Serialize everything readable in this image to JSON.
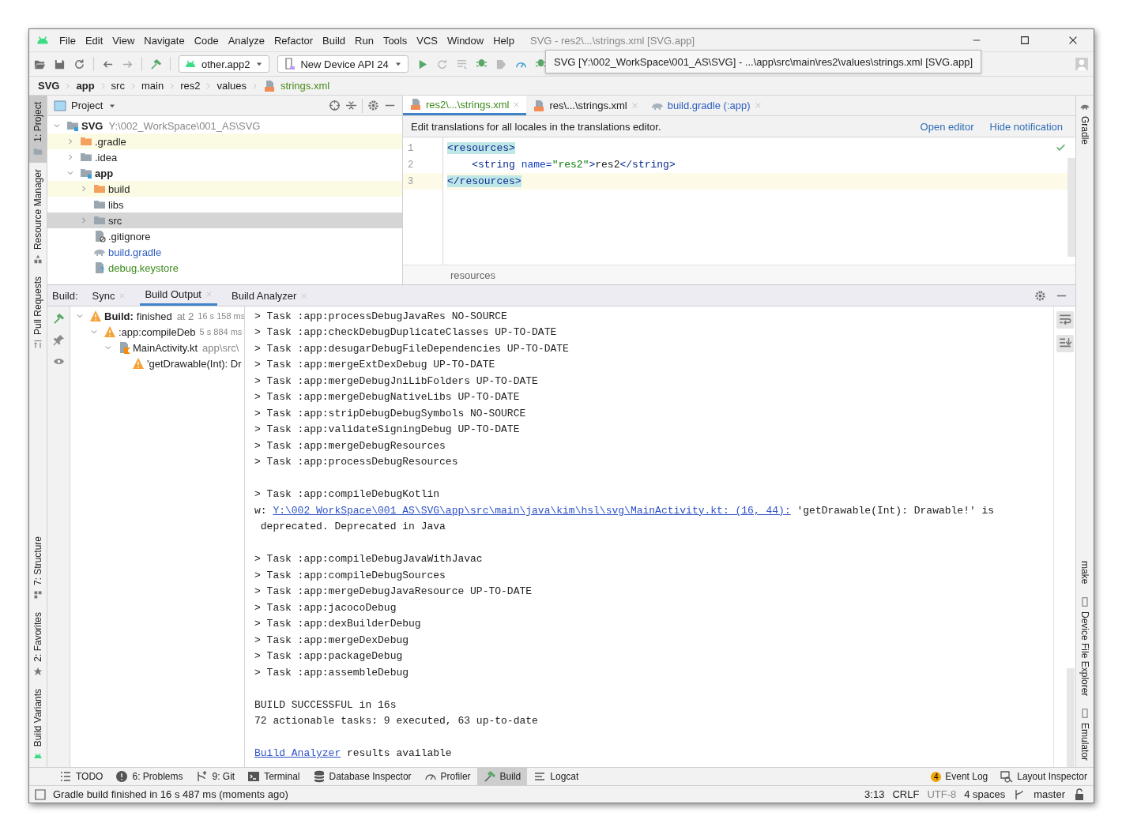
{
  "window": {
    "title": "SVG - res2\\...\\strings.xml [SVG.app]"
  },
  "menu": [
    "File",
    "Edit",
    "View",
    "Navigate",
    "Code",
    "Analyze",
    "Refactor",
    "Build",
    "Run",
    "Tools",
    "VCS",
    "Window",
    "Help"
  ],
  "toolbar": {
    "run_config": "other.app2",
    "device": "New Device API 24"
  },
  "tooltip": "SVG [Y:\\002_WorkSpace\\001_AS\\SVG] - ...\\app\\src\\main\\res2\\values\\strings.xml [SVG.app]",
  "breadcrumb": [
    {
      "label": "SVG",
      "bold": true,
      "kind": "dir"
    },
    {
      "label": "app",
      "bold": true,
      "kind": "dir"
    },
    {
      "label": "src",
      "bold": false,
      "kind": "dir"
    },
    {
      "label": "main",
      "bold": false,
      "kind": "dir"
    },
    {
      "label": "res2",
      "bold": false,
      "kind": "dir"
    },
    {
      "label": "values",
      "bold": false,
      "kind": "dir"
    },
    {
      "label": "strings.xml",
      "bold": false,
      "kind": "xml"
    }
  ],
  "left_strip": {
    "top": [
      {
        "label": "1: Project",
        "selected": true
      },
      {
        "label": "Resource Manager",
        "selected": false
      },
      {
        "label": "Pull Requests",
        "selected": false
      }
    ],
    "bottom": [
      {
        "label": "7: Structure",
        "selected": false
      },
      {
        "label": "2: Favorites",
        "selected": false
      },
      {
        "label": "Build Variants",
        "selected": false
      }
    ]
  },
  "right_strip": {
    "top": [
      "Gradle"
    ],
    "bottom": [
      "make",
      "Device File Explorer",
      "Emulator"
    ]
  },
  "project": {
    "title": "Project",
    "tree": [
      {
        "label": "SVG",
        "bold": true,
        "detail": "Y:\\002_WorkSpace\\001_AS\\SVG",
        "kind": "module",
        "expanded": true,
        "excluded": false,
        "selected": false,
        "children": [
          {
            "label": ".gradle",
            "bold": false,
            "kind": "folder",
            "expanded": false,
            "excluded": true,
            "selected": false
          },
          {
            "label": ".idea",
            "bold": false,
            "kind": "folder",
            "expanded": false,
            "excluded": false,
            "selected": false
          },
          {
            "label": "app",
            "bold": true,
            "kind": "module",
            "expanded": true,
            "excluded": false,
            "selected": false,
            "children": [
              {
                "label": "build",
                "bold": false,
                "kind": "folder",
                "expanded": false,
                "excluded": true,
                "selected": false
              },
              {
                "label": "libs",
                "bold": false,
                "kind": "folder",
                "excluded": false,
                "selected": false
              },
              {
                "label": "src",
                "bold": false,
                "kind": "folder",
                "expanded": false,
                "excluded": false,
                "selected": true
              },
              {
                "label": ".gitignore",
                "bold": false,
                "kind": "ignored-file",
                "excluded": false,
                "selected": false
              },
              {
                "label": "build.gradle",
                "bold": false,
                "kind": "gradle-file",
                "color": "#2f5fbf",
                "excluded": false,
                "selected": false
              },
              {
                "label": "debug.keystore",
                "bold": false,
                "kind": "unknown-file",
                "color": "#3e8a1e",
                "excluded": false,
                "selected": false
              }
            ]
          }
        ]
      }
    ]
  },
  "editor": {
    "tabs": [
      {
        "label": "res2\\...\\strings.xml",
        "kind": "xml",
        "color": "#3e8a1e",
        "selected": true
      },
      {
        "label": "res\\...\\strings.xml",
        "kind": "xml",
        "color": "#222222",
        "selected": false
      },
      {
        "label": "build.gradle (:app)",
        "kind": "gradle",
        "color": "#2f5fbf",
        "selected": false
      }
    ],
    "notification": {
      "text": "Edit translations for all locales in the translations editor.",
      "actions": [
        "Open editor",
        "Hide notification"
      ]
    },
    "lines": [
      {
        "number": "1",
        "current": false,
        "tokens": [
          {
            "kind": "tag",
            "text": "<resources>",
            "matched": true
          }
        ]
      },
      {
        "number": "2",
        "current": false,
        "tokens": [
          {
            "kind": "tag",
            "text": "    <string"
          },
          {
            "kind": "attr",
            "text": " name="
          },
          {
            "kind": "string",
            "text": "\"res2\""
          },
          {
            "kind": "tag",
            "text": ">"
          },
          {
            "kind": "plain",
            "text": "res2"
          },
          {
            "kind": "tag",
            "text": "</string>"
          }
        ]
      },
      {
        "number": "3",
        "current": true,
        "tokens": [
          {
            "kind": "tag",
            "text": "</resources>",
            "matched": true
          }
        ]
      }
    ],
    "breadcrumb": "resources"
  },
  "build": {
    "label": "Build:",
    "tabs": [
      {
        "label": "Sync",
        "selected": false
      },
      {
        "label": "Build Output",
        "selected": true
      },
      {
        "label": "Build Analyzer",
        "selected": false
      }
    ],
    "tree": [
      {
        "title": "Build:",
        "text": "finished",
        "detail": "at 2",
        "time": "16 s 158 ms",
        "kind": "warning",
        "expanded": true,
        "children": [
          {
            "text": ":app:compileDeb",
            "time": "5 s 884 ms",
            "kind": "warning",
            "expanded": true,
            "children": [
              {
                "text": "MainActivity.kt",
                "detail": "app\\src\\",
                "kind": "kotlin-file",
                "expanded": true,
                "children": [
                  {
                    "text": "'getDrawable(Int): Dr",
                    "kind": "warning"
                  }
                ]
              }
            ]
          }
        ]
      }
    ],
    "console": [
      {
        "kind": "text",
        "text": "> Task :app:processDebugJavaRes NO-SOURCE"
      },
      {
        "kind": "text",
        "text": "> Task :app:checkDebugDuplicateClasses UP-TO-DATE"
      },
      {
        "kind": "text",
        "text": "> Task :app:desugarDebugFileDependencies UP-TO-DATE"
      },
      {
        "kind": "text",
        "text": "> Task :app:mergeExtDexDebug UP-TO-DATE"
      },
      {
        "kind": "text",
        "text": "> Task :app:mergeDebugJniLibFolders UP-TO-DATE"
      },
      {
        "kind": "text",
        "text": "> Task :app:mergeDebugNativeLibs UP-TO-DATE"
      },
      {
        "kind": "text",
        "text": "> Task :app:stripDebugDebugSymbols NO-SOURCE"
      },
      {
        "kind": "text",
        "text": "> Task :app:validateSigningDebug UP-TO-DATE"
      },
      {
        "kind": "text",
        "text": "> Task :app:mergeDebugResources"
      },
      {
        "kind": "text",
        "text": "> Task :app:processDebugResources"
      },
      {
        "kind": "blank"
      },
      {
        "kind": "text",
        "text": "> Task :app:compileDebugKotlin"
      },
      {
        "kind": "linked",
        "before": "w: ",
        "link": "Y:\\002_WorkSpace\\001_AS\\SVG\\app\\src\\main\\java\\kim\\hsl\\svg\\MainActivity.kt: (16, 44):",
        "after": " 'getDrawable(Int): Drawable!' is"
      },
      {
        "kind": "text",
        "text": " deprecated. Deprecated in Java"
      },
      {
        "kind": "blank"
      },
      {
        "kind": "text",
        "text": "> Task :app:compileDebugJavaWithJavac"
      },
      {
        "kind": "text",
        "text": "> Task :app:compileDebugSources"
      },
      {
        "kind": "text",
        "text": "> Task :app:mergeDebugJavaResource UP-TO-DATE"
      },
      {
        "kind": "text",
        "text": "> Task :app:jacocoDebug"
      },
      {
        "kind": "text",
        "text": "> Task :app:dexBuilderDebug"
      },
      {
        "kind": "text",
        "text": "> Task :app:mergeDexDebug"
      },
      {
        "kind": "text",
        "text": "> Task :app:packageDebug"
      },
      {
        "kind": "text",
        "text": "> Task :app:assembleDebug"
      },
      {
        "kind": "blank"
      },
      {
        "kind": "text",
        "text": "BUILD SUCCESSFUL in 16s"
      },
      {
        "kind": "text",
        "text": "72 actionable tasks: 9 executed, 63 up-to-date"
      },
      {
        "kind": "blank"
      },
      {
        "kind": "linked",
        "link": "Build Analyzer",
        "after": " results available"
      }
    ]
  },
  "tool_windows": {
    "left": [
      {
        "label": "TODO",
        "selected": false
      },
      {
        "label": "6: Problems",
        "selected": false
      },
      {
        "label": "9: Git",
        "selected": false
      },
      {
        "label": "Terminal",
        "selected": false
      },
      {
        "label": "Database Inspector",
        "selected": false
      },
      {
        "label": "Profiler",
        "selected": false
      },
      {
        "label": "Build",
        "selected": true
      },
      {
        "label": "Logcat",
        "selected": false
      }
    ],
    "right": [
      {
        "label": "Event Log",
        "badge": "4"
      },
      {
        "label": "Layout Inspector"
      }
    ]
  },
  "status_bar": {
    "message": "Gradle build finished in 16 s 487 ms (moments ago)",
    "items": [
      {
        "label": "3:13",
        "muted": false
      },
      {
        "label": "CRLF",
        "muted": false
      },
      {
        "label": "UTF-8",
        "muted": true
      },
      {
        "label": "4 spaces",
        "muted": false
      },
      {
        "label": "master",
        "muted": false
      }
    ]
  }
}
